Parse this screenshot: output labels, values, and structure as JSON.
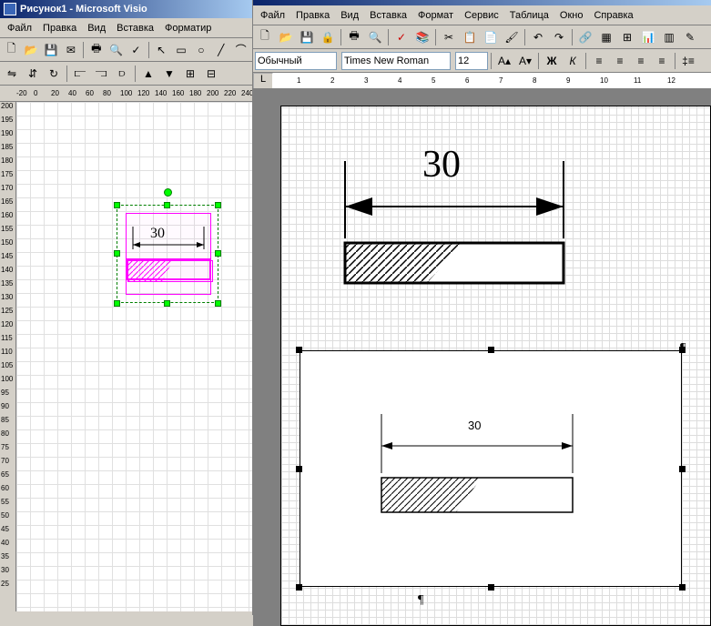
{
  "visio": {
    "title": "Рисунок1 - Microsoft Visio",
    "menu": [
      "Файл",
      "Правка",
      "Вид",
      "Вставка",
      "Форматир"
    ],
    "ruler_h": [
      "-20",
      "0",
      "20",
      "40",
      "60",
      "80",
      "100",
      "120",
      "140",
      "160",
      "180",
      "200",
      "220",
      "240"
    ],
    "ruler_v": [
      "200",
      "195",
      "190",
      "185",
      "180",
      "175",
      "170",
      "165",
      "160",
      "155",
      "150",
      "145",
      "140",
      "135",
      "130",
      "125",
      "120",
      "115",
      "110",
      "105",
      "100",
      "95",
      "90",
      "85",
      "80",
      "75",
      "70",
      "65",
      "60",
      "55",
      "50",
      "45",
      "40",
      "35",
      "30",
      "25"
    ],
    "dimension_label": "30"
  },
  "word": {
    "menu": [
      "Файл",
      "Правка",
      "Вид",
      "Вставка",
      "Формат",
      "Сервис",
      "Таблица",
      "Окно",
      "Справка"
    ],
    "style": "Обычный",
    "font": "Times New Roman",
    "size": "12",
    "ruler_marks": [
      "1",
      "2",
      "3",
      "4",
      "5",
      "6",
      "7",
      "8",
      "9",
      "10",
      "11",
      "12"
    ],
    "figure1_label": "30",
    "figure2_label": "30"
  }
}
